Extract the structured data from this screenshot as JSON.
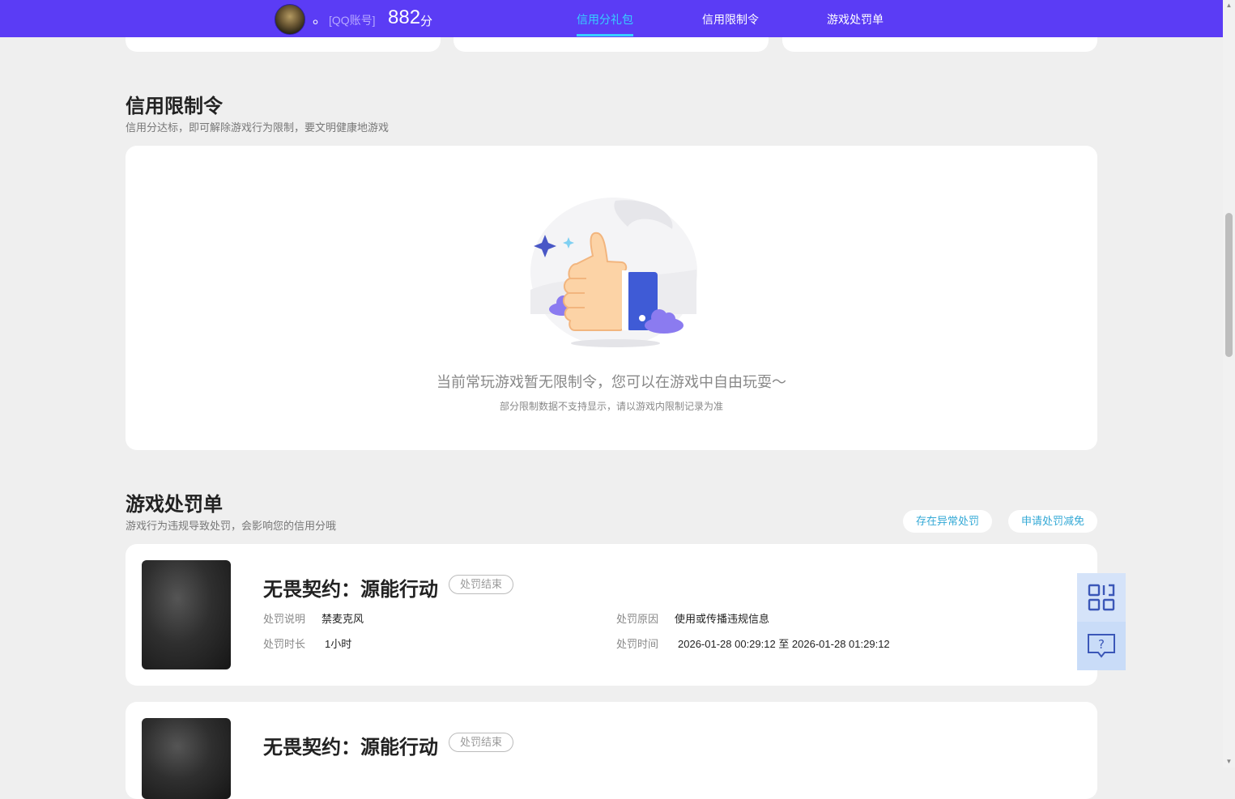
{
  "header": {
    "nickname": "。",
    "account_type": "[QQ账号]",
    "score": "882",
    "score_unit": "分",
    "tabs": [
      {
        "label": "信用分礼包",
        "active": true
      },
      {
        "label": "信用限制令",
        "active": false
      },
      {
        "label": "游戏处罚单",
        "active": false
      }
    ],
    "bar_color": "#5b3cf5",
    "active_color": "#36d0ff"
  },
  "restriction": {
    "title": "信用限制令",
    "subtitle": "信用分达标，即可解除游戏行为限制，要文明健康地游戏",
    "empty_icon": "thumbs-up-illustration",
    "empty_main": "当前常玩游戏暂无限制令，您可以在游戏中自由玩耍～",
    "empty_note": "部分限制数据不支持显示，请以游戏内限制记录为准"
  },
  "penalty": {
    "title": "游戏处罚单",
    "subtitle": "游戏行为违规导致处罚，会影响您的信用分哦",
    "abnormal_button": "存在异常处罚",
    "reduce_button": "申请处罚减免",
    "labels": {
      "desc": "处罚说明",
      "reason": "处罚原因",
      "duration": "处罚时长",
      "time": "处罚时间"
    },
    "items": [
      {
        "game": "无畏契约：源能行动",
        "status": "处罚结束",
        "desc": "禁麦克风",
        "reason": "使用或传播违规信息",
        "duration": "1小时",
        "time": "2026-01-28 00:29:12 至 2026-01-28 01:29:12"
      },
      {
        "game": "无畏契约：源能行动",
        "status": "处罚结束"
      }
    ]
  },
  "float_buttons": [
    {
      "icon": "qr-code-icon"
    },
    {
      "icon": "help-chat-icon"
    }
  ]
}
